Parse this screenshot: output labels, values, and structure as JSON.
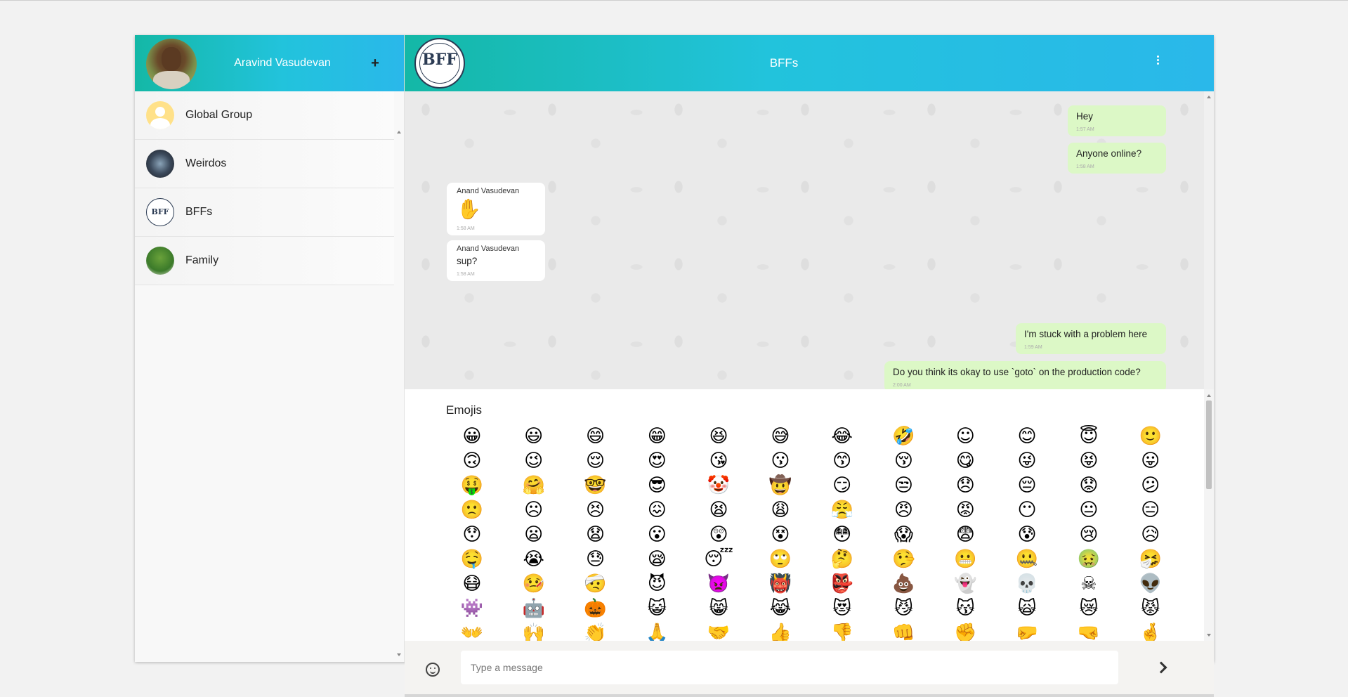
{
  "sidebar": {
    "user_name": "Aravind Vasudevan",
    "add_label": "+",
    "groups": [
      {
        "name": "Global Group"
      },
      {
        "name": "Weirdos"
      },
      {
        "name": "BFFs"
      },
      {
        "name": "Family"
      }
    ]
  },
  "chat": {
    "title": "BFFs",
    "avatar_text": "BFF",
    "messages": [
      {
        "direction": "out",
        "text": "Hey",
        "time": "1:57 AM"
      },
      {
        "direction": "out",
        "text": "Anyone online?",
        "time": "1:58 AM"
      },
      {
        "direction": "in",
        "sender": "Anand Vasudevan",
        "text": "✋",
        "time": "1:58 AM"
      },
      {
        "direction": "in",
        "sender": "Anand Vasudevan",
        "text": "sup?",
        "time": "1:58 AM"
      },
      {
        "direction": "out",
        "text": "I'm stuck with a problem here",
        "time": "1:59 AM"
      },
      {
        "direction": "out",
        "text": "Do you think its okay to use `goto` on the production code?",
        "time": "2:00 AM"
      }
    ]
  },
  "emoji_panel": {
    "title": "Emojis",
    "rows": [
      [
        "😀",
        "😃",
        "😄",
        "😁",
        "😆",
        "😅",
        "😂",
        "🤣",
        "☺",
        "😊",
        "😇",
        "🙂"
      ],
      [
        "🙃",
        "😉",
        "😌",
        "😍",
        "😘",
        "😗",
        "😙",
        "😚",
        "😋",
        "😜",
        "😝",
        "😛"
      ],
      [
        "🤑",
        "🤗",
        "🤓",
        "😎",
        "🤡",
        "🤠",
        "😏",
        "😒",
        "😞",
        "😔",
        "😟",
        "😕"
      ],
      [
        "🙁",
        "☹",
        "😣",
        "😖",
        "😫",
        "😩",
        "😤",
        "😠",
        "😡",
        "😶",
        "😐",
        "😑"
      ],
      [
        "😯",
        "😦",
        "😧",
        "😮",
        "😲",
        "😵",
        "😳",
        "😱",
        "😨",
        "😰",
        "😢",
        "😥"
      ],
      [
        "🤤",
        "😭",
        "😓",
        "😪",
        "😴",
        "🙄",
        "🤔",
        "🤥",
        "😬",
        "🤐",
        "🤢",
        "🤧"
      ],
      [
        "😷",
        "🤒",
        "🤕",
        "😈",
        "👿",
        "👹",
        "👺",
        "💩",
        "👻",
        "💀",
        "☠",
        "👽"
      ],
      [
        "👾",
        "🤖",
        "🎃",
        "😺",
        "😸",
        "😹",
        "😻",
        "😼",
        "😽",
        "🙀",
        "😿",
        "😾"
      ],
      [
        "👐",
        "🙌",
        "👏",
        "🙏",
        "🤝",
        "👍",
        "👎",
        "👊",
        "✊",
        "🤛",
        "🤜",
        "🤞"
      ]
    ]
  },
  "composer": {
    "placeholder": "Type a message",
    "value": ""
  },
  "icons": {
    "emoji_button": "smile-icon",
    "send_button": "chevron-right-icon",
    "menu_button": "more-vert-icon"
  },
  "colors": {
    "header_start": "#14b8a6",
    "header_end": "#2ab8ea",
    "outgoing_bubble": "#dcf8c6",
    "incoming_bubble": "#ffffff"
  }
}
